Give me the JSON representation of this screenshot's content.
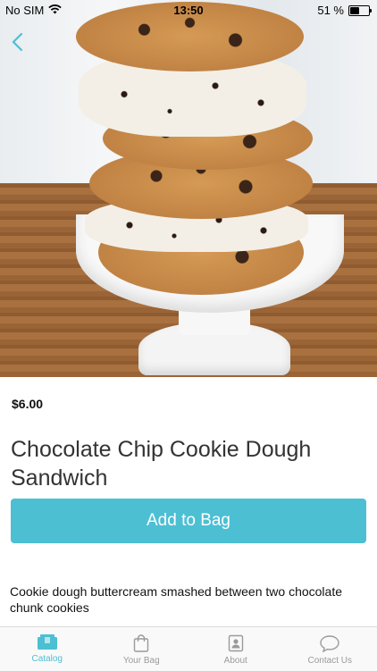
{
  "status_bar": {
    "carrier": "No SIM",
    "time": "13:50",
    "battery": "51 %",
    "battery_level": 0.51
  },
  "product": {
    "price": "$6.00",
    "title": "Chocolate Chip Cookie Dough Sandwich",
    "add_button_label": "Add to Bag",
    "description": "Cookie dough buttercream smashed between two chocolate chunk cookies"
  },
  "tabbar": {
    "items": [
      {
        "label": "Catalog",
        "icon": "catalog-icon",
        "active": true
      },
      {
        "label": "Your Bag",
        "icon": "bag-icon",
        "active": false
      },
      {
        "label": "About",
        "icon": "about-icon",
        "active": false
      },
      {
        "label": "Contact Us",
        "icon": "chat-icon",
        "active": false
      }
    ]
  },
  "colors": {
    "accent": "#4cbfd3",
    "inactive_tab": "#9a9a9a"
  }
}
